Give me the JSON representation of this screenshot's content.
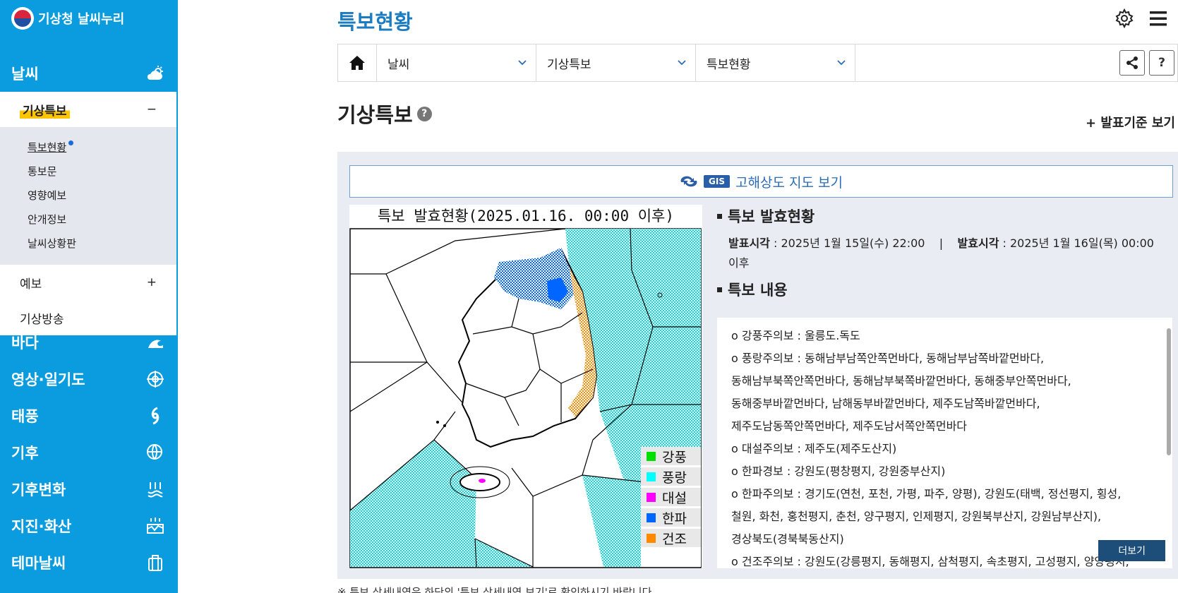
{
  "sidebar": {
    "logo": "기상청 날씨누리",
    "top_menu": "날씨",
    "sub_head": "기상특보",
    "sub_items": [
      "특보현황",
      "통보문",
      "영향예보",
      "안개정보",
      "날씨상황판"
    ],
    "rows": [
      {
        "label": "예보",
        "toggle": "+"
      },
      {
        "label": "기상방송",
        "toggle": ""
      }
    ],
    "sub_toggle": "−",
    "main_menu": [
      "바다",
      "영상·일기도",
      "태풍",
      "기후",
      "기후변화",
      "지진·화산",
      "테마날씨"
    ]
  },
  "header": {
    "title": "특보현황"
  },
  "breadcrumb": {
    "items": [
      "날씨",
      "기상특보",
      "특보현황"
    ],
    "help": "?"
  },
  "section": {
    "title": "기상특보",
    "help": "?",
    "criteria": "+ 발표기준 보기"
  },
  "gis": {
    "badge": "GIS",
    "label": "고해상도 지도 보기"
  },
  "map": {
    "title": "특보 발효현황(2025.01.16. 00:00 이후)",
    "legend": [
      {
        "label": "강풍",
        "color": "#00e000"
      },
      {
        "label": "풍랑",
        "color": "#00ffff"
      },
      {
        "label": "대설",
        "color": "#ff00ff"
      },
      {
        "label": "한파",
        "color": "#0066ff"
      },
      {
        "label": "건조",
        "color": "#ff8a00"
      }
    ]
  },
  "status": {
    "heading1": "특보 발효현황",
    "announce_label": "발표시각",
    "announce_value": " : 2025년 1월 15일(수) 22:00",
    "sep": "|",
    "effective_label": "발효시각",
    "effective_value": " : 2025년 1월 16일(목) 00:00",
    "after": "이후",
    "heading2": "특보 내용"
  },
  "content": [
    "o 강풍주의보 : 울릉도.독도",
    "o 풍랑주의보 : 동해남부남쪽안쪽먼바다, 동해남부남쪽바깥먼바다,",
    "동해남부북쪽안쪽먼바다, 동해남부북쪽바깥먼바다, 동해중부안쪽먼바다,",
    "동해중부바깥먼바다, 남해동부바깥먼바다, 제주도남쪽바깥먼바다,",
    "제주도남동쪽안쪽먼바다, 제주도남서쪽안쪽먼바다",
    "o 대설주의보 : 제주도(제주도산지)",
    "o 한파경보 : 강원도(평창평지, 강원중부산지)",
    "o 한파주의보 : 경기도(연천, 포천, 가평, 파주, 양평), 강원도(태백, 정선평지, 횡성,",
    "철원, 화천, 홍천평지, 춘천, 양구평지, 인제평지, 강원북부산지, 강원남부산지),",
    "경상북도(경북북동산지)",
    "o 건조주의보 : 강원도(강릉평지, 동해평지, 삼척평지, 속초평지, 고성평지, 양양평지,"
  ],
  "more_label": "더보기",
  "note": "※ 특보 상세내역은 하단의 '특보 상세내역 보기'로 확인하시기 바랍니다."
}
